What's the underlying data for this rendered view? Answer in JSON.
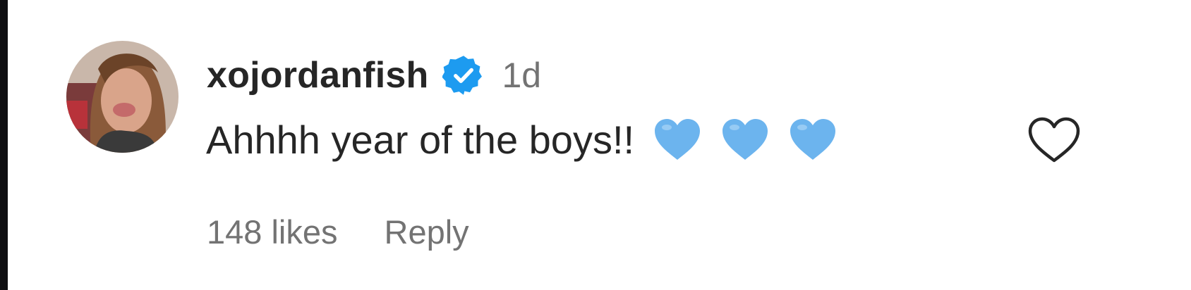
{
  "comment": {
    "username": "xojordanfish",
    "verified": true,
    "time_ago": "1d",
    "text": "Ahhhh year of the boys!!",
    "emojis": [
      "blue-heart",
      "blue-heart",
      "blue-heart"
    ],
    "likes_label": "148 likes",
    "reply_label": "Reply"
  },
  "icons": {
    "verified": "verified-badge-icon",
    "like": "heart-outline-icon",
    "emoji": "blue-heart-icon"
  },
  "colors": {
    "verified_blue": "#1d9bf0",
    "emoji_blue": "#6cb4ee",
    "text_primary": "#262626",
    "text_secondary": "#737373"
  }
}
